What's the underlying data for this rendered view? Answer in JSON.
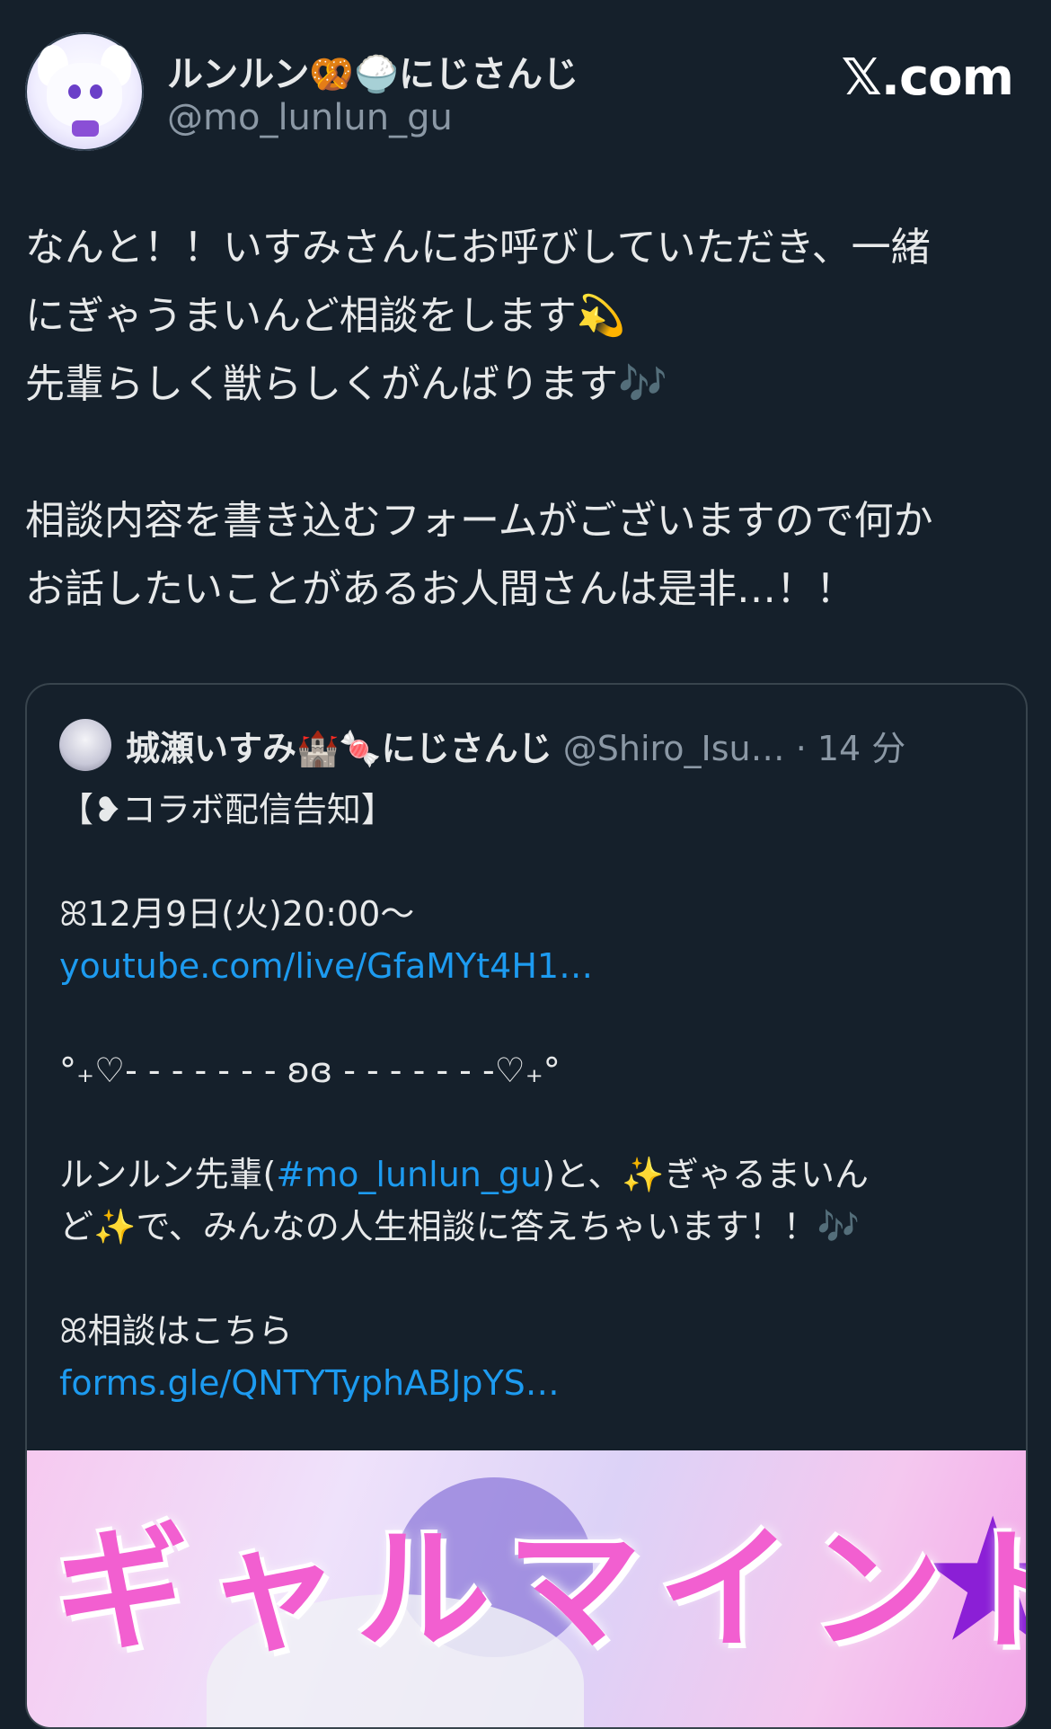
{
  "header": {
    "display_name": "ルンルン🥨🍚にじさんじ",
    "handle": "@mo_lunlun_gu",
    "brand": "𝕏.com"
  },
  "tweet": {
    "lines": [
      "なんと！！いすみさんにお呼びしていただき、一緒",
      "にぎゃうまいんど相談をします💫",
      "先輩らしく獣らしくがんばります🎶",
      "",
      "相談内容を書き込むフォームがございますので何か",
      "お話したいことがあるお人間さんは是非…！！"
    ]
  },
  "quote": {
    "author_name": "城瀬いすみ🏰🍬にじさんじ",
    "author_handle": "@Shiro_Isu…",
    "time": "· 14 分",
    "title": "【❥コラボ配信告知】",
    "date_line": "ꕤ12月9日(火)20:00〜",
    "link1": "youtube.com/live/GfaMYt4H1…",
    "divider": "°₊♡- - - - - - - ʚɞ - - - - - - -♡₊°",
    "body_line1_pre": "ルンルン先輩(",
    "body_hashtag": "#mo_lunlun_gu",
    "body_line1_post": ")と、✨ぎゃるまいん",
    "body_line2": "ど✨で、みんなの人生相談に答えちゃいます！！🎶",
    "form_label": "ꕤ相談はこちら",
    "link2": "forms.gle/QNTYTyphABJpYS…",
    "banner_text": "ギャルマインド"
  },
  "colors": {
    "background": "#15202b",
    "text": "#e7e9ea",
    "secondary": "#8b98a5",
    "link": "#1d9bf0",
    "border": "#38444d"
  }
}
